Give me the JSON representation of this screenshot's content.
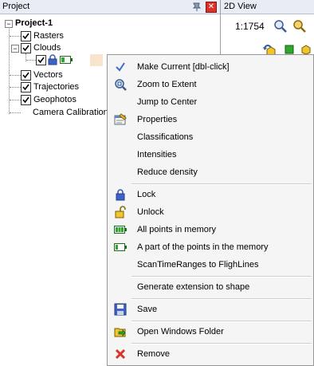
{
  "project_panel": {
    "title": "Project",
    "root": "Project-1",
    "items": [
      "Rasters",
      "Clouds",
      "Vectors",
      "Trajectories",
      "Geophotos",
      "Camera Calibration"
    ]
  },
  "view2d": {
    "title": "2D View",
    "scale": "1:1754"
  },
  "context_menu": {
    "items": [
      {
        "label": "Make Current [dbl-click]",
        "icon": "checkmark-icon"
      },
      {
        "label": "Zoom to Extent",
        "icon": "zoom-extent-icon"
      },
      {
        "label": "Jump to Center",
        "icon": ""
      },
      {
        "label": "Properties",
        "icon": "properties-icon"
      },
      {
        "label": "Classifications",
        "icon": ""
      },
      {
        "label": "Intensities",
        "icon": ""
      },
      {
        "label": "Reduce density",
        "icon": ""
      },
      {
        "label": "Lock",
        "icon": "lock-icon"
      },
      {
        "label": "Unlock",
        "icon": "unlock-icon"
      },
      {
        "label": "All points in memory",
        "icon": "battery-full-icon"
      },
      {
        "label": "A part of the points in the memory",
        "icon": "battery-partial-icon"
      },
      {
        "label": "ScanTimeRanges to FlighLines",
        "icon": ""
      },
      {
        "label": "Generate extension to shape",
        "icon": ""
      },
      {
        "label": "Save",
        "icon": "floppy-disk-icon"
      },
      {
        "label": "Open Windows Folder",
        "icon": "open-folder-icon"
      },
      {
        "label": "Remove",
        "icon": "red-x-icon"
      }
    ]
  },
  "colors": {
    "header_bg": "#e8edf5",
    "menu_bg": "#f5f5f5",
    "close_red": "#d9322a",
    "check_blue": "#3a6fd0"
  }
}
